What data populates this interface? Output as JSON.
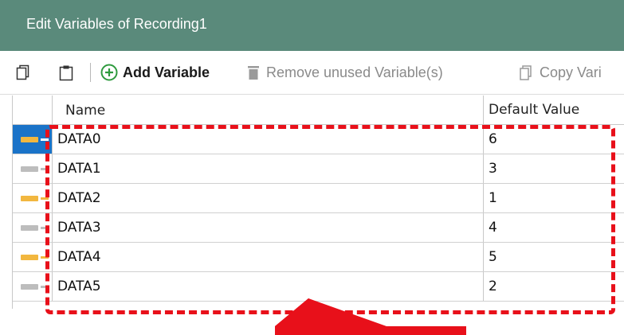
{
  "window": {
    "title": "Edit Variables of Recording1"
  },
  "toolbar": {
    "add_variable": "Add Variable",
    "remove_unused": "Remove unused Variable(s)",
    "copy_variables": "Copy Vari"
  },
  "grid": {
    "columns": {
      "name": "Name",
      "default_value": "Default Value"
    },
    "rows": [
      {
        "name": "DATA0",
        "value": "6",
        "indicator_color": "#f2b73f",
        "selected": true
      },
      {
        "name": "DATA1",
        "value": "3",
        "indicator_color": "#bdbdbd",
        "selected": false
      },
      {
        "name": "DATA2",
        "value": "1",
        "indicator_color": "#f2b73f",
        "selected": false
      },
      {
        "name": "DATA3",
        "value": "4",
        "indicator_color": "#bdbdbd",
        "selected": false
      },
      {
        "name": "DATA4",
        "value": "5",
        "indicator_color": "#f2b73f",
        "selected": false
      },
      {
        "name": "DATA5",
        "value": "2",
        "indicator_color": "#bdbdbd",
        "selected": false
      }
    ]
  },
  "colors": {
    "titlebar": "#5a8a7b",
    "selection": "#1a73c8",
    "highlight": "#e8101a",
    "add_icon": "#2e9a3e"
  },
  "icons": [
    "copy-icon",
    "paste-icon",
    "add-circle-icon",
    "trash-icon",
    "copy-variables-icon"
  ]
}
